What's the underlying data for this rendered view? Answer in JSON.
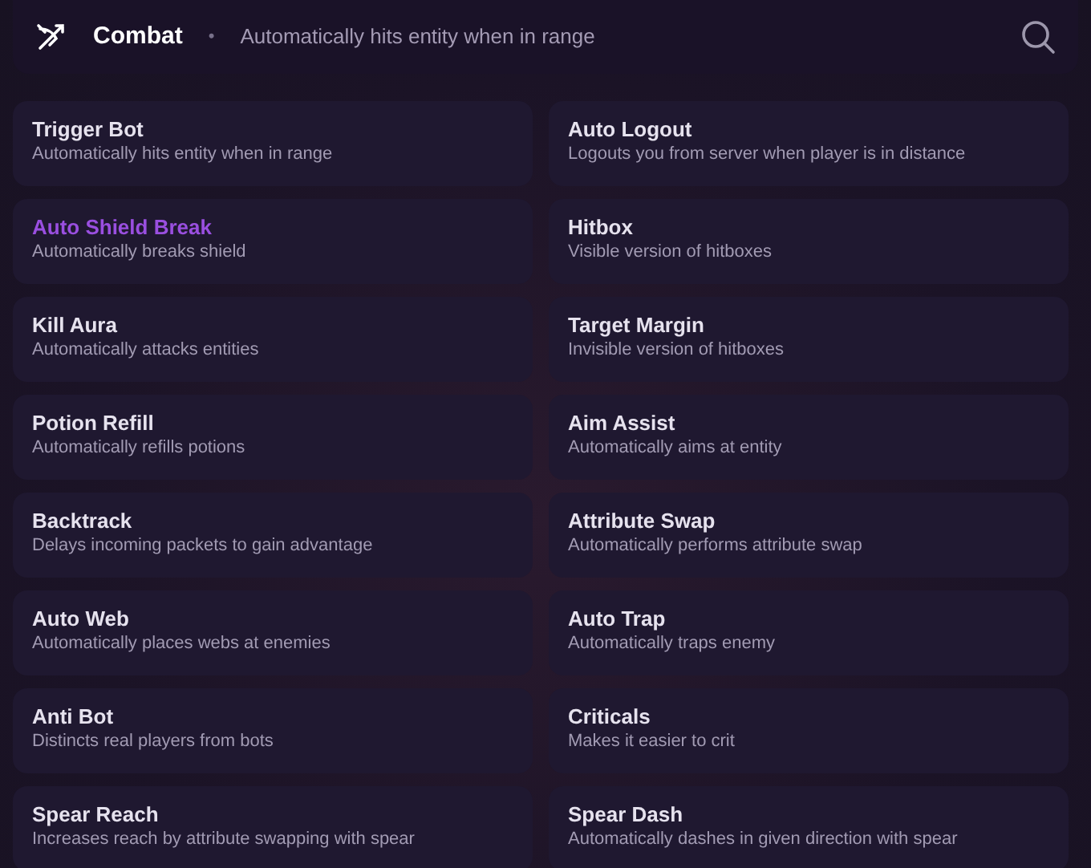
{
  "header": {
    "title": "Combat",
    "separator": "•",
    "description": "Automatically hits entity when in range"
  },
  "modules": [
    {
      "name": "Trigger Bot",
      "description": "Automatically hits entity when in range",
      "enabled": false
    },
    {
      "name": "Auto Logout",
      "description": "Logouts you from server when player is in distance",
      "enabled": false
    },
    {
      "name": "Auto Shield Break",
      "description": "Automatically breaks shield",
      "enabled": true
    },
    {
      "name": "Hitbox",
      "description": "Visible version of hitboxes",
      "enabled": false
    },
    {
      "name": "Kill Aura",
      "description": "Automatically attacks entities",
      "enabled": false
    },
    {
      "name": "Target Margin",
      "description": "Invisible version of hitboxes",
      "enabled": false
    },
    {
      "name": "Potion Refill",
      "description": "Automatically refills potions",
      "enabled": false
    },
    {
      "name": "Aim Assist",
      "description": "Automatically aims at entity",
      "enabled": false
    },
    {
      "name": "Backtrack",
      "description": "Delays incoming packets to gain advantage",
      "enabled": false
    },
    {
      "name": "Attribute Swap",
      "description": "Automatically performs attribute swap",
      "enabled": false
    },
    {
      "name": "Auto Web",
      "description": "Automatically places webs at enemies",
      "enabled": false
    },
    {
      "name": "Auto Trap",
      "description": "Automatically traps enemy",
      "enabled": false
    },
    {
      "name": "Anti Bot",
      "description": "Distincts real players from bots",
      "enabled": false
    },
    {
      "name": "Criticals",
      "description": "Makes it easier to crit",
      "enabled": false
    },
    {
      "name": "Spear Reach",
      "description": "Increases reach by attribute swapping with spear",
      "enabled": false
    },
    {
      "name": "Spear Dash",
      "description": "Automatically dashes in given direction with spear",
      "enabled": false
    }
  ]
}
